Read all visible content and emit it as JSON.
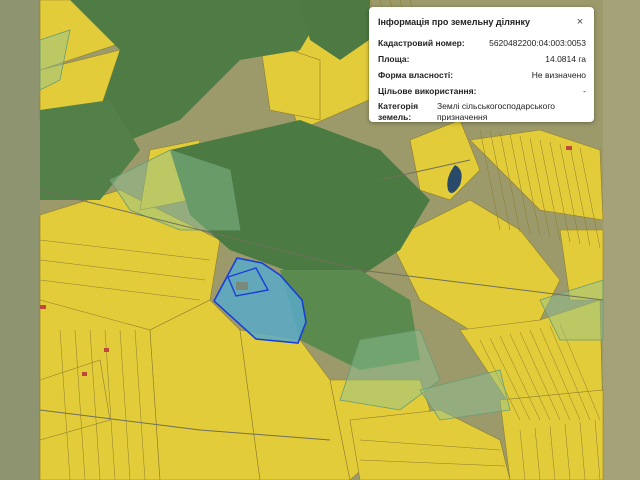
{
  "map": {
    "colors": {
      "background_field": "#9a9a6a",
      "forest": "#4f7c44",
      "forest_overlay": "#6aa46a",
      "agri_parcel": "#e3cd3a",
      "parcel_border": "#8a7a2a",
      "selected_fill": "#59a9c9",
      "selected_border": "#1a3fd6",
      "light_overlay": "#b8d8c0"
    },
    "icons": [
      "close-icon"
    ]
  },
  "popup": {
    "title": "Інформація про земельну ділянку",
    "close_label": "×",
    "fields": {
      "cadastral": {
        "label": "Кадастровий номер:",
        "value": "5620482200:04:003:0053"
      },
      "area": {
        "label": "Площа:",
        "value": "14.0814 га"
      },
      "ownership": {
        "label": "Форма власності:",
        "value": "Не визначено"
      },
      "purpose": {
        "label": "Цільове використання:",
        "value": "-"
      },
      "category": {
        "label_line1": "Категорія",
        "label_line2": "земель:",
        "value": "Землі сільськогосподарського призначення"
      }
    }
  }
}
